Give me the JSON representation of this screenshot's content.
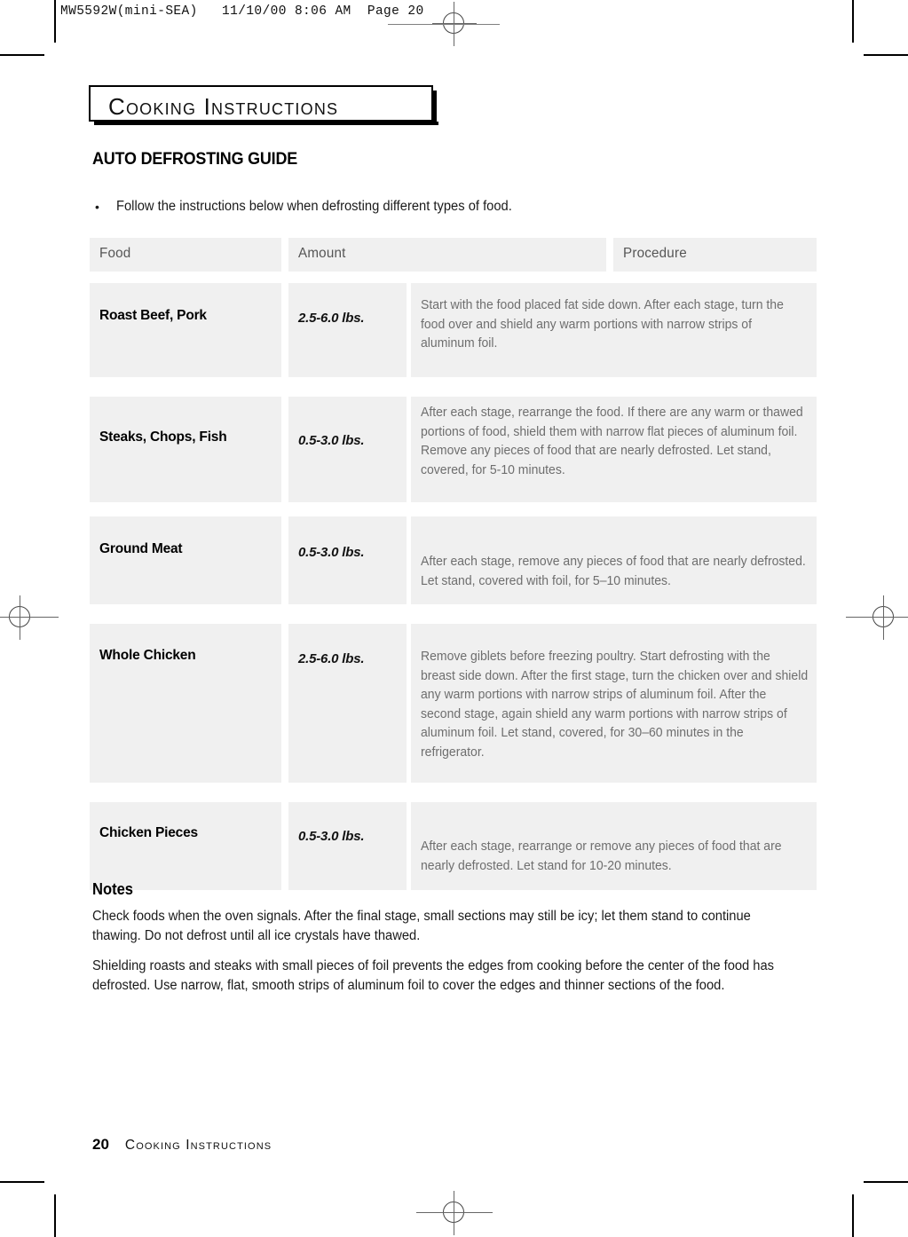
{
  "plate": {
    "slug": "MW5592W(mini-SEA)   11/10/00 8:06 AM  Page 20"
  },
  "header": {
    "title": "Cooking Instructions"
  },
  "section": {
    "heading": "AUTO DEFROSTING GUIDE",
    "bullet_marker": "•",
    "bullet_text": "Follow the instructions below when defrosting different types of food."
  },
  "table": {
    "columns": [
      "Food",
      "Amount",
      "Procedure"
    ],
    "rows": [
      {
        "food": "Roast Beef, Pork",
        "amount": "2.5-6.0 lbs.",
        "procedure": "Start with the food placed fat side down. After each stage, turn the food over and shield any warm portions with narrow strips of aluminum foil."
      },
      {
        "food": "Steaks, Chops, Fish",
        "amount": "0.5-3.0 lbs.",
        "procedure": "After each stage, rearrange the food. If there are any warm or thawed portions of food, shield them with narrow flat pieces of aluminum foil. Remove any pieces of food that are nearly defrosted. Let stand, covered, for 5-10 minutes."
      },
      {
        "food": "Ground Meat",
        "amount": "0.5-3.0 lbs.",
        "procedure": "After each stage, remove any pieces of food that are nearly defrosted. Let stand, covered with foil, for 5–10 minutes."
      },
      {
        "food": "Whole Chicken",
        "amount": "2.5-6.0 lbs.",
        "procedure": "Remove giblets before freezing poultry. Start defrosting with the breast side down. After the first stage, turn the chicken over and shield any warm portions with narrow strips of aluminum foil. After the second stage, again shield any warm portions with narrow strips of aluminum foil. Let stand, covered, for 30–60 minutes in the refrigerator."
      },
      {
        "food": "Chicken Pieces",
        "amount": "0.5-3.0 lbs.",
        "procedure": "After each stage, rearrange or remove any pieces of food that are nearly defrosted. Let stand for 10-20 minutes."
      }
    ]
  },
  "notes": {
    "heading": "Notes",
    "paragraph1": "Check foods when the oven signals. After the final stage, small sections may still be icy; let them stand to continue thawing. Do not defrost until all ice crystals have thawed.",
    "paragraph2": "Shielding roasts and steaks with small pieces of foil prevents the edges from cooking before the center of the food has defrosted. Use narrow, flat, smooth strips of aluminum foil to cover the edges and thinner sections of the food."
  },
  "footer": {
    "page_number": "20",
    "title": "Cooking Instructions"
  },
  "colors": {
    "cell_background": "#f0f0f0",
    "procedure_text": "#6e6e6e",
    "header_text": "#555555",
    "body_text": "#1a1a1a"
  }
}
